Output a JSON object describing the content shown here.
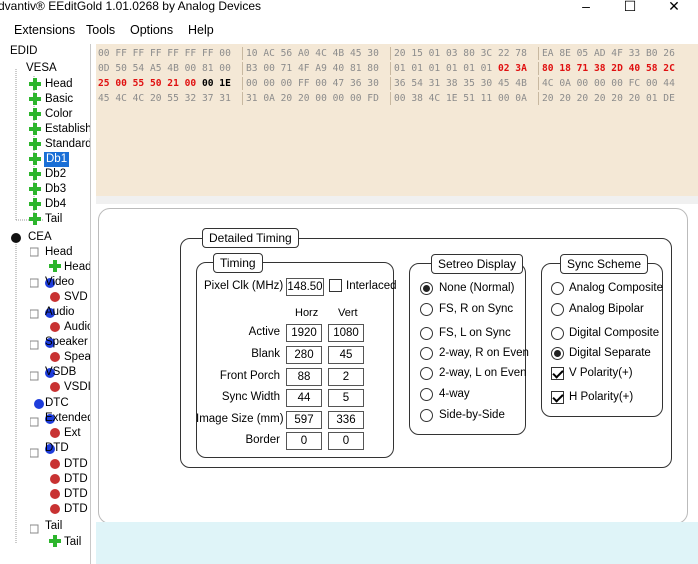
{
  "window": {
    "title": "dvantiv® EEditGold 1.01.0268 by Analog Devices",
    "minimize": "–",
    "maximize": "☐",
    "close": "✕"
  },
  "menu": [
    "Extensions",
    "Tools",
    "Options",
    "Help"
  ],
  "tree": {
    "items": [
      "EDID",
      "VESA",
      "Head",
      "Basic",
      "Color",
      "Establish",
      "Standard",
      "Db1",
      "Db2",
      "Db3",
      "Db4",
      "Tail",
      "CEA",
      "Head",
      "Head",
      "Video",
      "SVD",
      "Audio",
      "Audio",
      "Speaker",
      "Spea",
      "VSDB",
      "VSDI",
      "DTC",
      "Extended",
      "Ext",
      "DTD",
      "DTD",
      "DTD",
      "DTD",
      "DTD",
      "Tail",
      "Tail"
    ],
    "selected": "Db1"
  },
  "hex": {
    "rows": [
      [
        "00 FF FF FF FF FF FF 00",
        "10 AC 56 A0 4C 4B 45 30",
        "20 15 01 03 80 3C 22 78",
        "EA 8E 05 AD 4F 33 B0 26"
      ],
      [
        "0D 50 54 A5 4B 00 81 00",
        "B3 00 71 4F A9 40 81 80",
        "01 01 01 01 01 01 ",
        "80 18 71 38 2D 40 58 2C"
      ],
      [
        "",
        "00 00 00 FF 00 47 36 30",
        "36 54 31 38 35 30 45 4B",
        "4C 0A 00 00 00 FC 00 44"
      ],
      [
        "45 4C 4C 20 55 32 37 31",
        "31 0A 20 20 00 00 00 FD",
        "00 38 4C 1E 51 11 00 0A",
        "20 20 20 20 20 20 01 DE"
      ]
    ],
    "row1_highlight": "02 3A",
    "row2_red": "25 00 55 50 21 00",
    "row2_black": "00 1E"
  },
  "detailed_timing": {
    "title": "Detailed Timing",
    "timing": {
      "title": "Timing",
      "pixel_clk_label": "Pixel Clk (MHz)",
      "pixel_clk_value": "148.50",
      "interlaced_label": "Interlaced",
      "interlaced_checked": false,
      "col_horz": "Horz",
      "col_vert": "Vert",
      "rows": [
        {
          "label": "Active",
          "horz": "1920",
          "vert": "1080"
        },
        {
          "label": "Blank",
          "horz": "280",
          "vert": "45"
        },
        {
          "label": "Front Porch",
          "horz": "88",
          "vert": "2"
        },
        {
          "label": "Sync Width",
          "horz": "44",
          "vert": "5"
        },
        {
          "label": "Image Size (mm)",
          "horz": "597",
          "vert": "336"
        },
        {
          "label": "Border",
          "horz": "0",
          "vert": "0"
        }
      ]
    },
    "stereo": {
      "title": "Setreo Display",
      "options": [
        "None (Normal)",
        "FS, R on Sync",
        "FS, L on Sync",
        "2-way, R on Even",
        "2-way, L on Even",
        "4-way",
        "Side-by-Side"
      ],
      "selected": "None (Normal)"
    },
    "sync": {
      "title": "Sync Scheme",
      "options": [
        "Analog Composite",
        "Analog Bipolar",
        "Digital Composite",
        "Digital Separate"
      ],
      "selected": "Digital Separate",
      "v_polarity_label": "V Polarity(+)",
      "v_polarity_checked": true,
      "h_polarity_label": "H Polarity(+)",
      "h_polarity_checked": true
    }
  },
  "colors": {
    "hex_bg": "#f4e8d6",
    "hex_red": "#e01010",
    "selection": "#1a6fd6",
    "lower_bg": "#dff4f8"
  }
}
